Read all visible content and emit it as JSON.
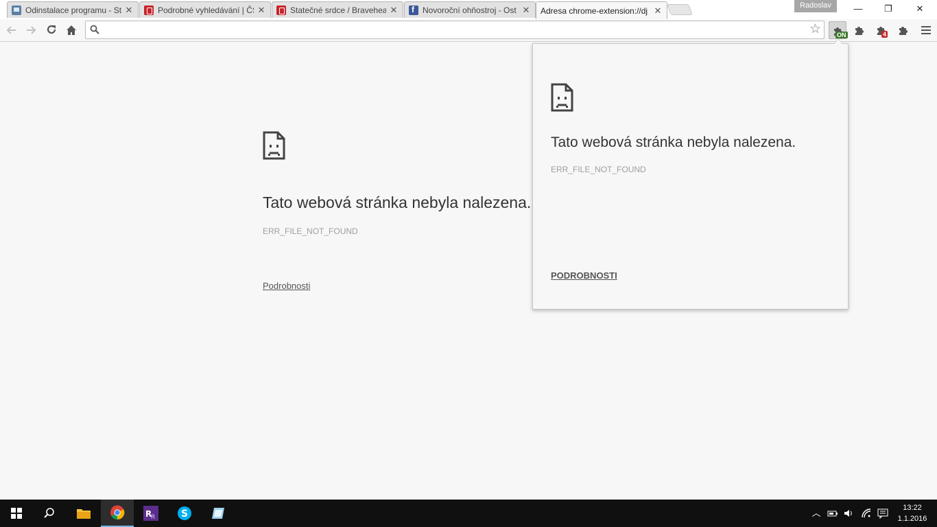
{
  "window": {
    "profile_name": "Radoslav",
    "minimize_label": "—",
    "restore_label": "❐",
    "close_label": "✕"
  },
  "tabs": [
    {
      "title": "Odinstalace programu - St",
      "favicon": "computer-icon",
      "active": false
    },
    {
      "title": "Podrobné vyhledávání | ČS",
      "favicon": "csfd-icon",
      "active": false
    },
    {
      "title": "Statečné srdce / Bravehear",
      "favicon": "csfd-icon",
      "active": false
    },
    {
      "title": "Novoroční ohňostroj - Ost",
      "favicon": "facebook-icon",
      "active": false
    },
    {
      "title": "Adresa chrome-extension://dj",
      "favicon": "none",
      "active": true
    }
  ],
  "toolbar": {
    "omnibox_value": "",
    "extension_badges": {
      "on_badge": "ON",
      "count_badge": "4"
    }
  },
  "page": {
    "error_title": "Tato webová stránka nebyla nalezena.",
    "error_code": "ERR_FILE_NOT_FOUND",
    "details_link": "Podrobnosti"
  },
  "popup": {
    "error_title": "Tato webová stránka nebyla nalezena.",
    "error_code": "ERR_FILE_NOT_FOUND",
    "details_link": "PODROBNOSTI"
  },
  "taskbar": {
    "time": "13:22",
    "date": "1.1.2016"
  },
  "colors": {
    "page_background": "#f7f7f7",
    "taskbar_background": "#101010",
    "accent_blue": "#76b9ed"
  }
}
